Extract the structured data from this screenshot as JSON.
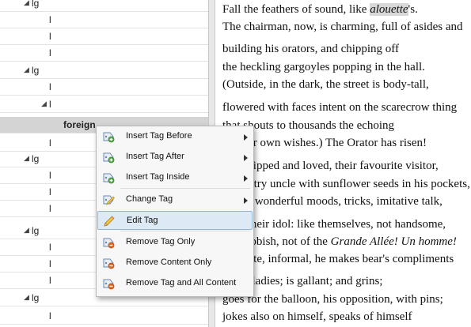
{
  "tree": {
    "rows": [
      {
        "label": "lg",
        "expander": "◢",
        "depth": 1
      },
      {
        "label": "l",
        "expander": "",
        "depth": 2
      },
      {
        "label": "l",
        "expander": "",
        "depth": 2
      },
      {
        "label": "l",
        "expander": "",
        "depth": 2
      },
      {
        "label": "lg",
        "expander": "◢",
        "depth": 1
      },
      {
        "label": "l",
        "expander": "",
        "depth": 2
      },
      {
        "label": "l",
        "expander": "◢",
        "depth": 2
      },
      {
        "label": "foreign",
        "expander": "",
        "depth": 3,
        "selected": true
      },
      {
        "label": "l",
        "expander": "",
        "depth": 2
      },
      {
        "label": "lg",
        "expander": "◢",
        "depth": 1
      },
      {
        "label": "l",
        "expander": "",
        "depth": 2
      },
      {
        "label": "l",
        "expander": "",
        "depth": 2
      },
      {
        "label": "l",
        "expander": "",
        "depth": 2
      },
      {
        "label": "lg",
        "expander": "◢",
        "depth": 1
      },
      {
        "label": "l",
        "expander": "",
        "depth": 2
      },
      {
        "label": "l",
        "expander": "",
        "depth": 2
      },
      {
        "label": "l",
        "expander": "",
        "depth": 2
      },
      {
        "label": "lg",
        "expander": "◢",
        "depth": 1
      },
      {
        "label": "l",
        "expander": "",
        "depth": 2
      }
    ]
  },
  "text": {
    "lines": [
      {
        "pre": "Fall the feathers of sound, like ",
        "em": "alouette",
        "post": "'s."
      },
      {
        "pre": "The chairman, now, is charming, full of asides and",
        "em": "",
        "post": ""
      },
      {
        "pre": "building his orators, and chipping off",
        "em": "",
        "post": ""
      },
      {
        "pre": "the heckling gargoyles popping in the hall.",
        "em": "",
        "post": ""
      },
      {
        "pre": "(Outside, in the dark, the street is body-tall,",
        "em": "",
        "post": ""
      },
      {
        "pre": "flowered with faces intent on the scarecrow thing",
        "em": "",
        "post": ""
      },
      {
        "pre": "that shouts to thousands the echoing",
        "em": "",
        "post": ""
      },
      {
        "pre": "of their own wishes.) The Orator has risen!",
        "em": "",
        "post": ""
      },
      {
        "pre": "Worshipped and loved, their favourite visitor,",
        "em": "",
        "post": ""
      },
      {
        "pre": "a country uncle with sunflower seeds in his pockets,",
        "em": "",
        "post": ""
      },
      {
        "pre": "full of wonderful moods, tricks, imitative talk,",
        "em": "",
        "post": ""
      },
      {
        "pre": "he is their idol: like themselves, not handsome,",
        "em": "",
        "post": ""
      },
      {
        "pre": "not rubbish, not of the ",
        "em": "Grande Allée! Un homme!",
        "post": ""
      },
      {
        "pre": "Intimate, informal, he makes bear's compliments",
        "em": "",
        "post": ""
      },
      {
        "pre": "to the ladies; is gallant; and grins;",
        "em": "",
        "post": ""
      },
      {
        "pre": "goes for the balloon, his opposition, with pins;",
        "em": "",
        "post": ""
      },
      {
        "pre": "jokes also on himself, speaks of himself",
        "em": "",
        "post": ""
      }
    ]
  },
  "menu": {
    "items": [
      {
        "label": "Insert Tag Before",
        "icon": "insert-tag-icon",
        "submenu": true
      },
      {
        "label": "Insert Tag After",
        "icon": "insert-tag-icon",
        "submenu": true
      },
      {
        "label": "Insert Tag Inside",
        "icon": "insert-tag-icon",
        "submenu": true
      },
      {
        "label": "Change Tag",
        "icon": "change-tag-icon",
        "submenu": true
      },
      {
        "label": "Edit Tag",
        "icon": "edit-tag-icon",
        "submenu": false,
        "hover": true
      },
      {
        "label": "Remove Tag Only",
        "icon": "remove-tag-icon",
        "submenu": false
      },
      {
        "label": "Remove Content Only",
        "icon": "remove-tag-icon",
        "submenu": false
      },
      {
        "label": "Remove Tag and All Content",
        "icon": "remove-tag-icon",
        "submenu": false
      }
    ]
  },
  "colors": {
    "selected_row": "#d4d4d4",
    "menu_hover": "#dde9f4",
    "highlight": "#d8d8d8"
  }
}
